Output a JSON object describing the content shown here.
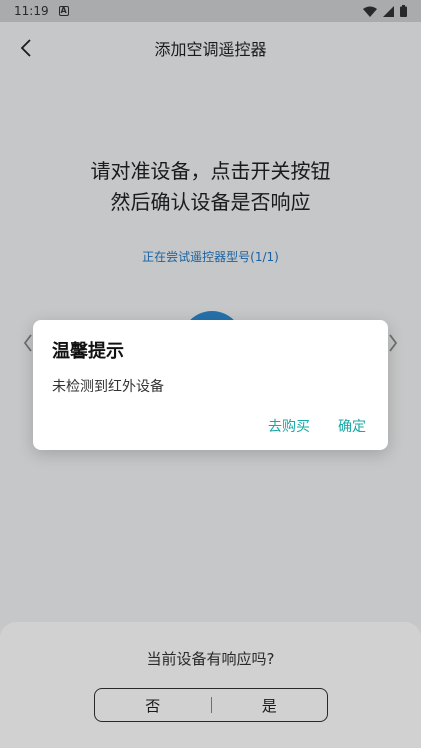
{
  "status_bar": {
    "time": "11:19",
    "notification_icon": "a-icon",
    "icons": [
      "wifi-icon",
      "signal-icon",
      "battery-icon"
    ]
  },
  "app_bar": {
    "title": "添加空调遥控器",
    "back_icon": "chevron-left-icon"
  },
  "main": {
    "instruction_line1": "请对准设备，点击开关按钮",
    "instruction_line2": "然后确认设备是否响应",
    "model_try": "正在尝试遥控器型号(1/1)",
    "power_button_color": "#2e8ad2"
  },
  "bottom": {
    "question": "当前设备有响应吗?",
    "no_label": "否",
    "yes_label": "是"
  },
  "dialog": {
    "title": "温馨提示",
    "message": "未检测到红外设备",
    "buy_label": "去购买",
    "confirm_label": "确定",
    "accent_color": "#17a9a6"
  }
}
